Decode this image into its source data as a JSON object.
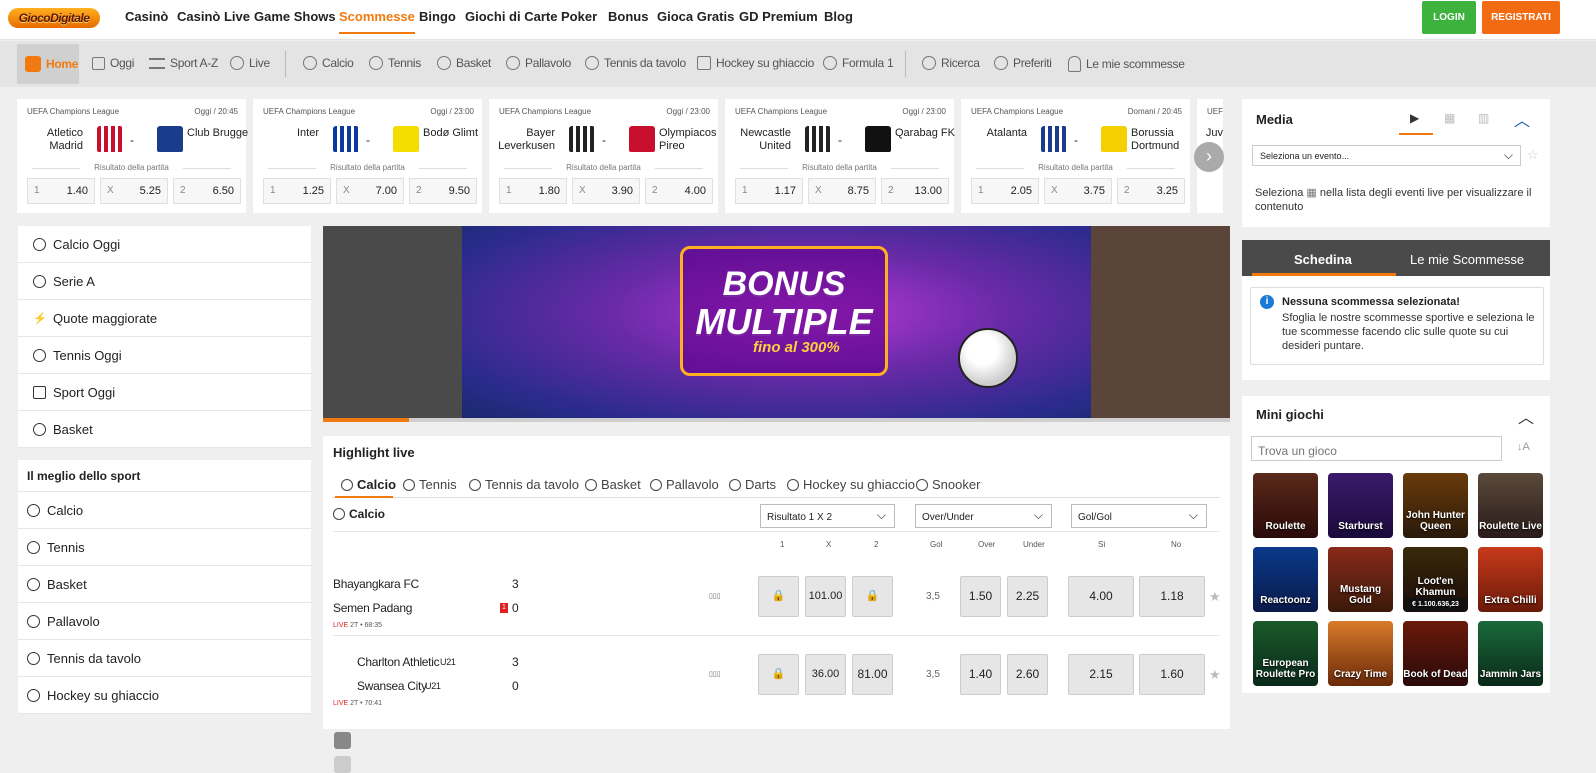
{
  "topnav": {
    "logo": "GiocoDigitale",
    "items": [
      "Casinò",
      "Casinò Live",
      "Game Shows",
      "Scommesse",
      "Bingo",
      "Giochi di Carte",
      "Poker",
      "Bonus",
      "Gioca Gratis",
      "GD Premium",
      "Blog"
    ],
    "active": "Scommesse",
    "login": "LOGIN",
    "register": "REGISTRATI",
    "colors": {
      "login": "#3db33d",
      "register": "#f26b12",
      "accent": "#f07a10"
    }
  },
  "sportbar": {
    "items": [
      "Home",
      "Oggi",
      "Sport A-Z",
      "Live",
      "Calcio",
      "Tennis",
      "Basket",
      "Pallavolo",
      "Tennis da tavolo",
      "Hockey su ghiaccio",
      "Formula 1",
      "Ricerca",
      "Preferiti",
      "Le mie scommesse"
    ]
  },
  "matches": [
    {
      "league": "UEFA Champions League",
      "time": "Oggi / 20:45",
      "home": "Atletico Madrid",
      "away": "Club Brugge",
      "result_label": "Risultato della partita",
      "odds": [
        {
          "k": "1",
          "v": "1.40"
        },
        {
          "k": "X",
          "v": "5.25"
        },
        {
          "k": "2",
          "v": "6.50"
        }
      ]
    },
    {
      "league": "UEFA Champions League",
      "time": "Oggi / 23:00",
      "home": "Inter",
      "away": "Bodø Glimt",
      "result_label": "Risultato della partita",
      "odds": [
        {
          "k": "1",
          "v": "1.25"
        },
        {
          "k": "X",
          "v": "7.00"
        },
        {
          "k": "2",
          "v": "9.50"
        }
      ]
    },
    {
      "league": "UEFA Champions League",
      "time": "Oggi / 23:00",
      "home": "Bayer Leverkusen",
      "away": "Olympiacos Pireo",
      "result_label": "Risultato della partita",
      "odds": [
        {
          "k": "1",
          "v": "1.80"
        },
        {
          "k": "X",
          "v": "3.90"
        },
        {
          "k": "2",
          "v": "4.00"
        }
      ]
    },
    {
      "league": "UEFA Champions League",
      "time": "Oggi / 23:00",
      "home": "Newcastle United",
      "away": "Qarabag FK",
      "result_label": "Risultato della partita",
      "odds": [
        {
          "k": "1",
          "v": "1.17"
        },
        {
          "k": "X",
          "v": "8.75"
        },
        {
          "k": "2",
          "v": "13.00"
        }
      ]
    },
    {
      "league": "UEFA Champions League",
      "time": "Domani / 20:45",
      "home": "Atalanta",
      "away": "Borussia Dortmund",
      "result_label": "Risultato della partita",
      "odds": [
        {
          "k": "1",
          "v": "2.05"
        },
        {
          "k": "X",
          "v": "3.75"
        },
        {
          "k": "2",
          "v": "3.25"
        }
      ]
    },
    {
      "league": "UEF",
      "time": "",
      "home": "Juv",
      "away": "",
      "result_label": "",
      "odds": []
    }
  ],
  "leftmenu": {
    "top": [
      "Calcio Oggi",
      "Serie A",
      "Quote maggiorate",
      "Tennis Oggi",
      "Sport Oggi",
      "Basket"
    ],
    "section_title": "Il meglio dello sport",
    "best": [
      "Calcio",
      "Tennis",
      "Basket",
      "Pallavolo",
      "Tennis da tavolo",
      "Hockey su ghiaccio"
    ]
  },
  "banner": {
    "line1": "BONUS",
    "line2": "MULTIPLE",
    "line3": "fino al 300%",
    "progress": 0.095
  },
  "highlight": {
    "title": "Highlight live",
    "tabs": [
      "Calcio",
      "Tennis",
      "Tennis da tavolo",
      "Basket",
      "Pallavolo",
      "Darts",
      "Hockey su ghiaccio",
      "Snooker"
    ],
    "sport": "Calcio",
    "selects": [
      "Risultato 1 X 2",
      "Over/Under",
      "Gol/Gol"
    ],
    "col_headers": [
      "1",
      "X",
      "2",
      "Gol",
      "Over",
      "Under",
      "Sì",
      "No"
    ],
    "rows": [
      {
        "home": "Bhayangkara FC",
        "away": "Semen Padang",
        "home_score": "3",
        "away_score": "0",
        "away_badge": "1",
        "live": "LIVE",
        "period": "2T • 68:35",
        "o1": "",
        "ox": "101.00",
        "o2": "",
        "gol": "3,5",
        "over": "1.50",
        "under": "2.25",
        "si": "4.00",
        "no": "1.18"
      },
      {
        "home": "Charlton Athletic",
        "home_tag": "U21",
        "away": "Swansea City",
        "away_tag": "U21",
        "home_score": "3",
        "away_score": "0",
        "live": "LIVE",
        "period": "2T • 70:41",
        "o1": "",
        "ox": "36.00",
        "o2": "81.00",
        "gol": "3,5",
        "over": "1.40",
        "under": "2.60",
        "si": "2.15",
        "no": "1.60"
      }
    ]
  },
  "media": {
    "title": "Media",
    "select_placeholder": "Seleziona un evento...",
    "text_a": "Seleziona",
    "text_b": "nella lista degli eventi live per visualizzare il contenuto"
  },
  "schedina": {
    "tab1": "Schedina",
    "tab2": "Le mie Scommesse",
    "title": "Nessuna scommessa selezionata!",
    "desc": "Sfoglia le nostre scommesse sportive e seleziona le tue scommesse facendo clic sulle quote su cui desideri puntare."
  },
  "mini": {
    "title": "Mini giochi",
    "search_placeholder": "Trova un gioco",
    "games": [
      "Roulette",
      "Starburst",
      "John Hunter Queen",
      "Roulette Live",
      "Reactoonz",
      "Mustang Gold",
      "Loot'en Khamun",
      "Extra Chilli",
      "European Roulette Pro",
      "Crazy Time",
      "Book of Dead",
      "Jammin Jars"
    ],
    "jackpot": "€ 1.100.636,23"
  }
}
